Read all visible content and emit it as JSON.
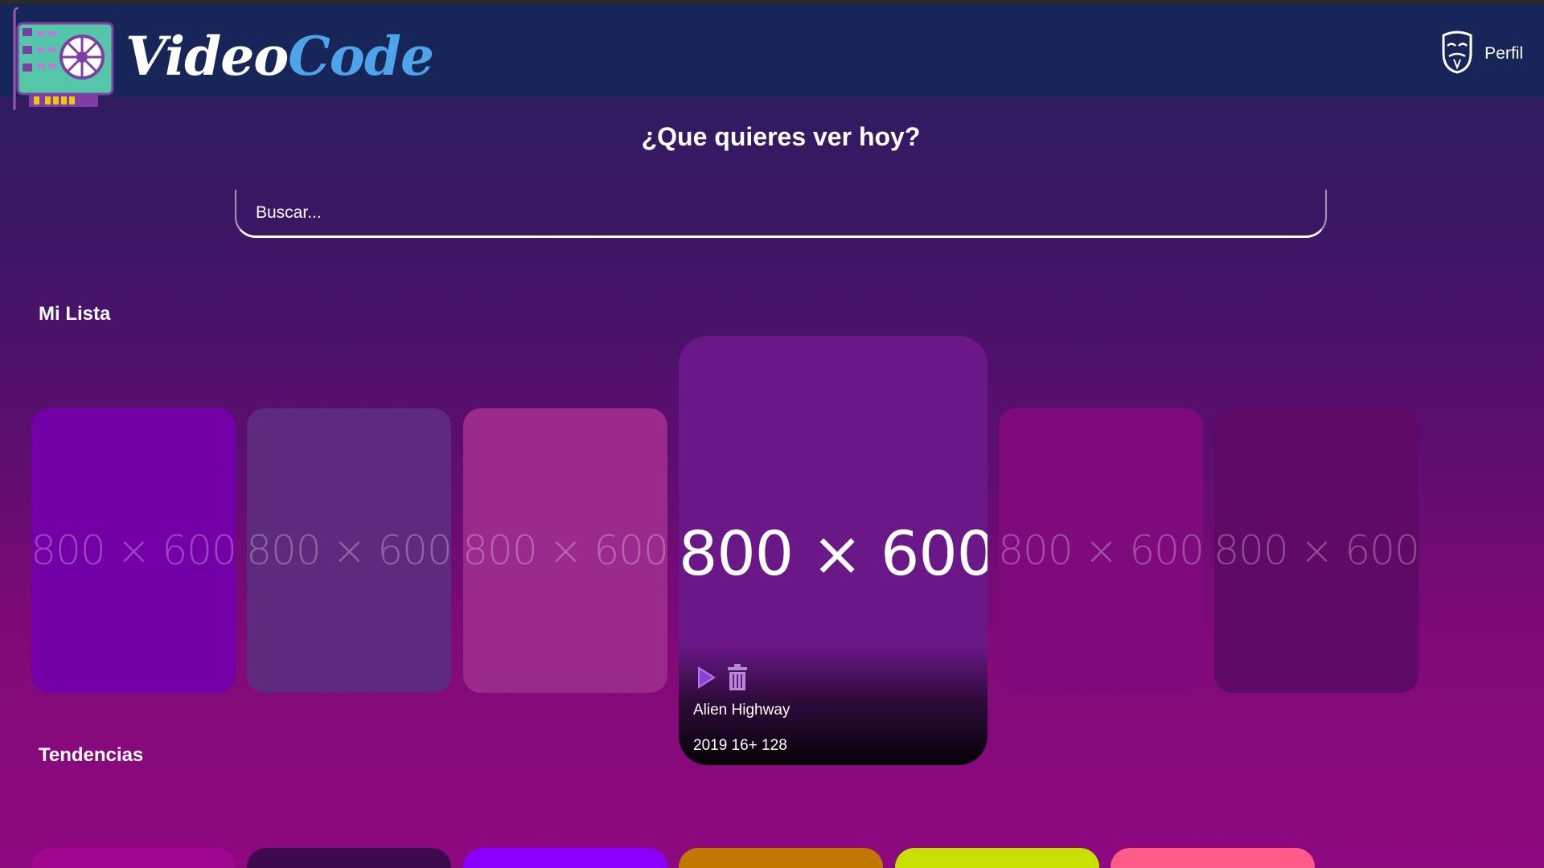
{
  "app": {
    "brand_part1": "Video",
    "brand_part2": "Code",
    "profile_label": "Perfil"
  },
  "headline": "¿Que quieres ver hoy?",
  "search": {
    "placeholder": "Buscar..."
  },
  "sections": {
    "my_list": {
      "title": "Mi Lista",
      "cards": [
        {
          "placeholder": "800 × 600",
          "color": "#7300a6"
        },
        {
          "placeholder": "800 × 600",
          "color": "#5e2a7e"
        },
        {
          "placeholder": "800 × 600",
          "color": "#9a2a8c"
        },
        {
          "placeholder": "800 × 600",
          "color": "#7e0a7e"
        },
        {
          "placeholder": "800 × 600",
          "color": "#5e0a66"
        }
      ],
      "featured": {
        "placeholder": "800 × 600",
        "title": "Alien Highway",
        "meta": "2019 16+ 128",
        "color": "#6a1888"
      }
    },
    "trending": {
      "title": "Tendencias",
      "cards": [
        {
          "color": "#a0078f"
        },
        {
          "color": "#3d0a4e"
        },
        {
          "color": "#8a00ff"
        },
        {
          "color": "#c07800"
        },
        {
          "color": "#c8e000"
        },
        {
          "color": "#ff5a88"
        }
      ]
    }
  },
  "icons": {
    "logo": "video-card-logo-icon",
    "profile": "mask-icon",
    "play": "play-icon",
    "delete": "trash-icon"
  }
}
